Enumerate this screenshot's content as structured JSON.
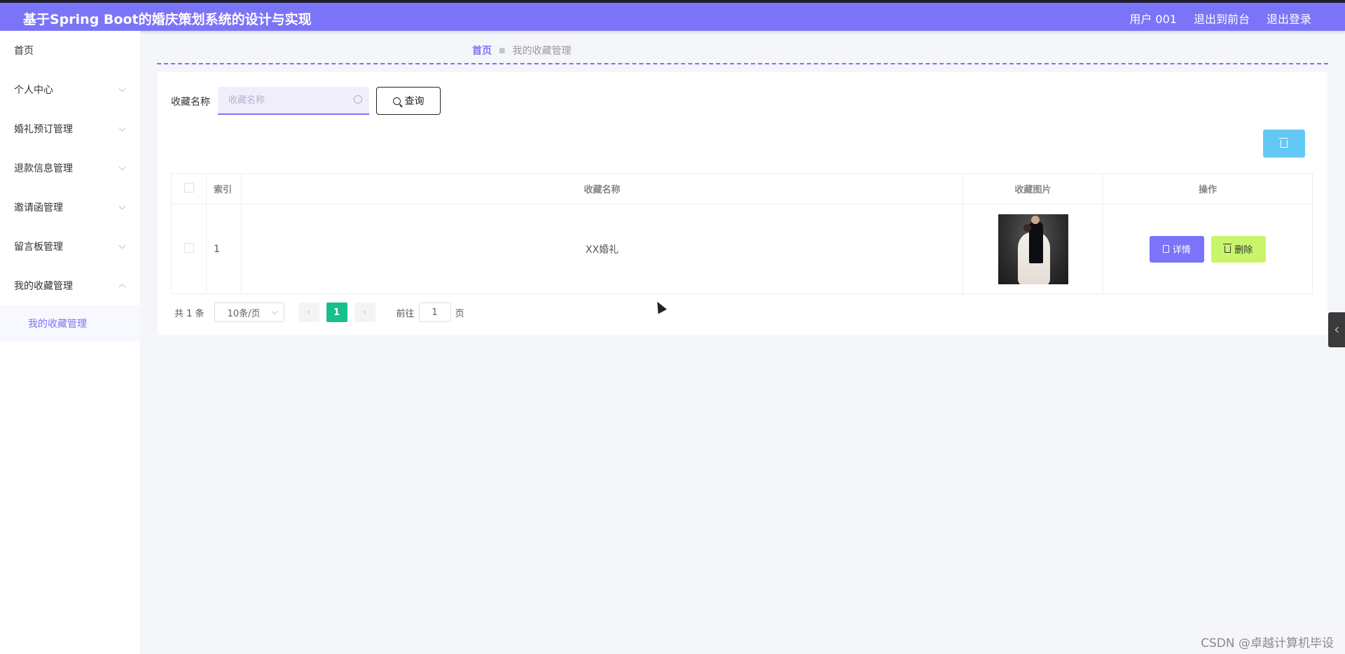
{
  "header": {
    "title": "基于Spring Boot的婚庆策划系统的设计与实现",
    "user": "用户 001",
    "back_to_front": "退出到前台",
    "logout": "退出登录"
  },
  "sidebar": {
    "items": [
      {
        "label": "首页"
      },
      {
        "label": "个人中心"
      },
      {
        "label": "婚礼预订管理"
      },
      {
        "label": "退款信息管理"
      },
      {
        "label": "邀请函管理"
      },
      {
        "label": "留言板管理"
      },
      {
        "label": "我的收藏管理"
      }
    ],
    "active_sub": "我的收藏管理"
  },
  "breadcrumb": {
    "home": "首页",
    "current": "我的收藏管理"
  },
  "search": {
    "label": "收藏名称",
    "placeholder": "收藏名称",
    "value": "",
    "button": "查询"
  },
  "table": {
    "headers": [
      "索引",
      "收藏名称",
      "收藏图片",
      "操作"
    ],
    "rows": [
      {
        "index": "1",
        "name": "XX婚礼",
        "image_alt": "婚纱照"
      }
    ],
    "detail_label": "详情",
    "delete_label": "删除"
  },
  "pagination": {
    "total": "共 1 条",
    "page_size": "10条/页",
    "current_page": "1",
    "goto_label": "前往",
    "goto_value": "1",
    "page_suffix": "页"
  },
  "watermark": "CSDN @卓越计算机毕设",
  "colors": {
    "primary": "#7b74f8",
    "info": "#64c8f5",
    "danger_lime": "#c8f56b",
    "page_active": "#17c08a"
  },
  "icons": [
    "search-icon",
    "trash-icon",
    "document-icon",
    "chevron-down-icon",
    "chevron-left-icon",
    "chevron-right-icon"
  ]
}
